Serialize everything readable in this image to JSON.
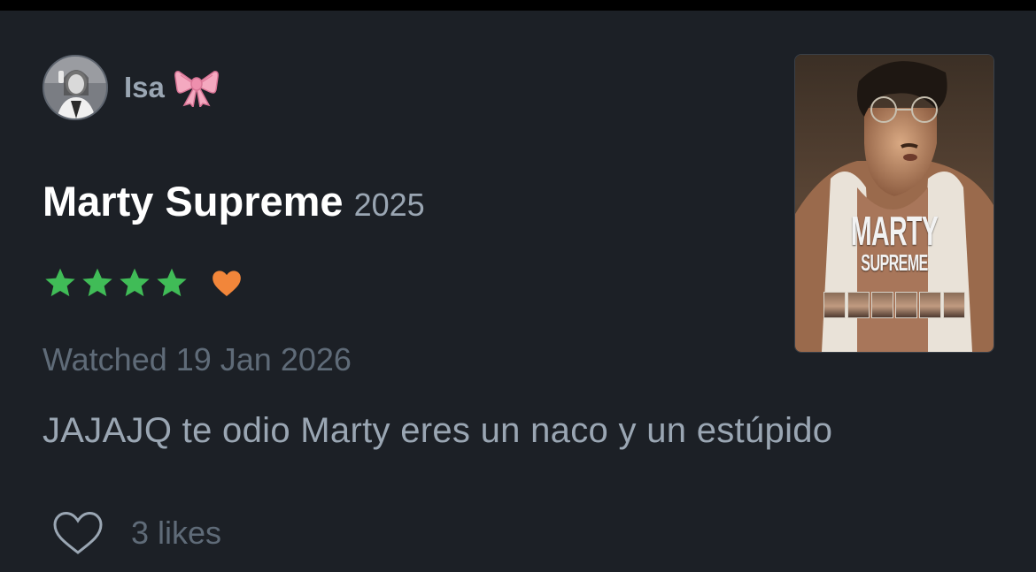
{
  "review": {
    "user": {
      "name": "Isa",
      "emoji_icon": "ribbon-bow-icon",
      "avatar": "avatar"
    },
    "film": {
      "title": "Marty Supreme",
      "year": "2025"
    },
    "rating": {
      "stars": 4,
      "max_stars": 5,
      "liked": true,
      "star_color": "#40bc57",
      "heart_color": "#f2863a"
    },
    "watched_label": "Watched 19 Jan 2026",
    "text": "JAJAJQ te odio Marty eres un naco y un estúpido",
    "likes_label": "3 likes"
  },
  "poster": {
    "title_line1": "MARTY",
    "title_line2": "SUPREME"
  },
  "colors": {
    "background": "#1c2026",
    "title": "#ffffff",
    "muted": "#5f6b78",
    "secondary": "#9aa6b3"
  }
}
